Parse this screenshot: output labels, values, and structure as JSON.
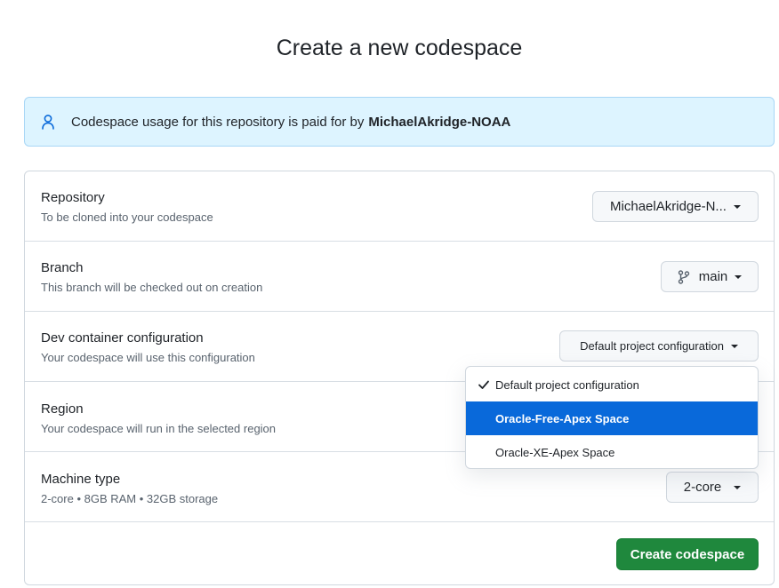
{
  "title": "Create a new codespace",
  "notice": {
    "text": "Codespace usage for this repository is paid for by",
    "owner": "MichaelAkridge-NOAA",
    "icon": "person-icon"
  },
  "repository": {
    "label": "Repository",
    "description": "To be cloned into your codespace",
    "value": "MichaelAkridge-N..."
  },
  "branch": {
    "label": "Branch",
    "description": "This branch will be checked out on creation",
    "value": "main",
    "icon": "git-branch-icon"
  },
  "devcontainer": {
    "label": "Dev container configuration",
    "description": "Your codespace will use this configuration",
    "value": "Default project configuration",
    "options": [
      {
        "label": "Default project configuration",
        "selected": true
      },
      {
        "label": "Oracle-Free-Apex Space",
        "highlighted": true
      },
      {
        "label": "Oracle-XE-Apex Space"
      }
    ]
  },
  "region": {
    "label": "Region",
    "description": "Your codespace will run in the selected region"
  },
  "machine": {
    "label": "Machine type",
    "description": "2-core • 8GB RAM • 32GB storage",
    "value": "2-core"
  },
  "submit_label": "Create codespace",
  "colors": {
    "primary": "#1f883d",
    "accent": "#0969da",
    "notice_bg": "#ddf4ff"
  }
}
